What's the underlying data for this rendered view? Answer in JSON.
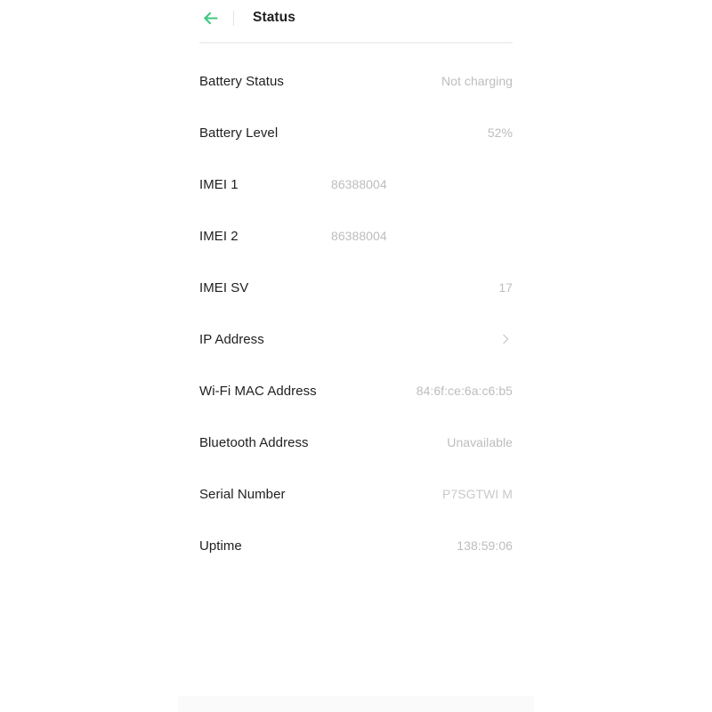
{
  "header": {
    "back_icon": "arrow-left-icon",
    "title": "Status",
    "accent_color": "#3cc87d",
    "divider_color": "#f0f0f0"
  },
  "colors": {
    "label": "#1f1f1f",
    "value": "#bdbdbd",
    "background": "#ffffff",
    "bottom_bar": "#fafafa"
  },
  "rows": [
    {
      "label": "Battery Status",
      "value": "Not charging",
      "type": "value"
    },
    {
      "label": "Battery Level",
      "value": "52%",
      "type": "value"
    },
    {
      "label": "IMEI 1",
      "value": "86388004",
      "type": "clipped"
    },
    {
      "label": "IMEI 2",
      "value": "86388004",
      "type": "clipped"
    },
    {
      "label": "IMEI SV",
      "value": "17",
      "type": "value"
    },
    {
      "label": "IP Address",
      "value": "",
      "type": "chevron",
      "chevron_icon": "chevron-right-icon"
    },
    {
      "label": "Wi-Fi MAC Address",
      "value": "84:6f:ce:6a:c6:b5",
      "type": "value"
    },
    {
      "label": "Bluetooth Address",
      "value": "Unavailable",
      "type": "value"
    },
    {
      "label": "Serial Number",
      "value": "P7SGTWI M",
      "type": "wrap"
    },
    {
      "label": "Uptime",
      "value": "138:59:06",
      "type": "value"
    }
  ]
}
